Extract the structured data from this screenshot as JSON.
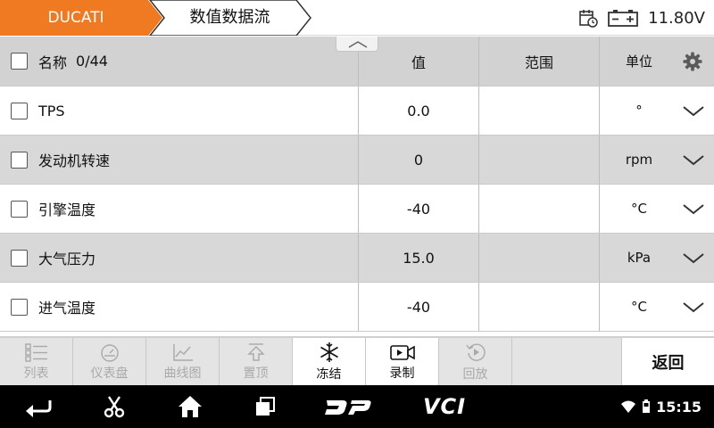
{
  "topbar": {
    "brand": "DUCATI",
    "page_title": "数值数据流",
    "voltage": "11.80V"
  },
  "table": {
    "header": {
      "name_label": "名称",
      "count": "0/44",
      "value_label": "值",
      "range_label": "范围",
      "unit_label": "单位"
    },
    "rows": [
      {
        "name": "TPS",
        "value": "0.0",
        "range": "",
        "unit": "°"
      },
      {
        "name": "发动机转速",
        "value": "0",
        "range": "",
        "unit": "rpm"
      },
      {
        "name": "引擎温度",
        "value": "-40",
        "range": "",
        "unit": "°C"
      },
      {
        "name": "大气压力",
        "value": "15.0",
        "range": "",
        "unit": "kPa"
      },
      {
        "name": "进气温度",
        "value": "-40",
        "range": "",
        "unit": "°C"
      }
    ]
  },
  "toolbar": {
    "list": "列表",
    "gauge": "仪表盘",
    "graph": "曲线图",
    "pin_top": "置顶",
    "freeze": "冻结",
    "record": "录制",
    "playback": "回放",
    "back": "返回"
  },
  "navbar": {
    "dp_label": "DP",
    "vci_label": "VCI",
    "clock": "15:15"
  },
  "colors": {
    "brand_orange": "#f07a22",
    "row_gray": "#d8d8d8",
    "header_gray": "#d2d2d2",
    "disabled_text": "#a9a9a9"
  }
}
